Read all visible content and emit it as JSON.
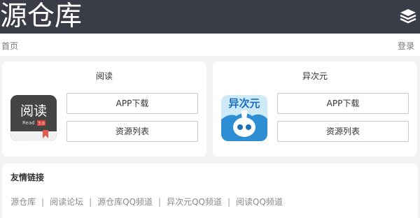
{
  "header": {
    "brand": "源仓库",
    "menu_icon": "layers-icon"
  },
  "subnav": {
    "home": "首页",
    "login": "登录"
  },
  "cards": [
    {
      "title": "阅读",
      "icon": {
        "text": "阅读",
        "subtext": "Read",
        "badge": "3.0",
        "bg": "#3f3f3f"
      },
      "buttons": [
        "APP下载",
        "资源列表"
      ]
    },
    {
      "title": "异次元",
      "icon": {
        "text": "异次元",
        "bg": "#bfe3f3"
      },
      "buttons": [
        "APP下载",
        "资源列表"
      ]
    }
  ],
  "friend_links": {
    "title": "友情链接",
    "items": [
      "源仓库",
      "阅读论坛",
      "源仓库QQ频道",
      "异次元QQ频道",
      "阅读QQ频道"
    ],
    "separator": "|"
  },
  "colors": {
    "header_bg": "#3a3c48",
    "page_bg": "#f3f3f3"
  }
}
